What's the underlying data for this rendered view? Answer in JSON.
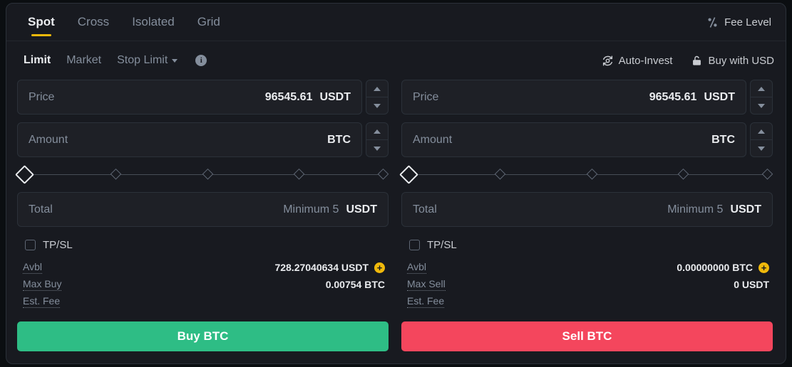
{
  "market_tabs": [
    {
      "label": "Spot",
      "active": true
    },
    {
      "label": "Cross",
      "active": false
    },
    {
      "label": "Isolated",
      "active": false
    },
    {
      "label": "Grid",
      "active": false
    }
  ],
  "fee_level": {
    "label": "Fee Level",
    "icon": "percent-icon"
  },
  "order_types": [
    {
      "label": "Limit",
      "active": true,
      "caret": false
    },
    {
      "label": "Market",
      "active": false,
      "caret": false
    },
    {
      "label": "Stop Limit",
      "active": false,
      "caret": true
    }
  ],
  "info_tooltip_icon": "info-icon",
  "quick_actions": [
    {
      "label": "Auto-Invest",
      "icon": "auto-invest-icon"
    },
    {
      "label": "Buy with USD",
      "icon": "bank-lock-icon"
    }
  ],
  "buy": {
    "price": {
      "label": "Price",
      "value": "96545.61",
      "unit": "USDT"
    },
    "amount": {
      "label": "Amount",
      "value": "",
      "unit": "BTC"
    },
    "slider": {
      "value": 0,
      "ticks": [
        0,
        25,
        50,
        75,
        100
      ]
    },
    "total": {
      "label": "Total",
      "hint": "Minimum 5",
      "unit": "USDT"
    },
    "tpsl": {
      "label": "TP/SL",
      "checked": false
    },
    "info": [
      {
        "key": "Avbl",
        "value": "728.27040634 USDT",
        "has_plus": true
      },
      {
        "key": "Max Buy",
        "value": "0.00754 BTC",
        "has_plus": false
      },
      {
        "key": "Est. Fee",
        "value": "",
        "has_plus": false
      }
    ],
    "button": {
      "label": "Buy BTC",
      "color": "#2ebd85"
    }
  },
  "sell": {
    "price": {
      "label": "Price",
      "value": "96545.61",
      "unit": "USDT"
    },
    "amount": {
      "label": "Amount",
      "value": "",
      "unit": "BTC"
    },
    "slider": {
      "value": 0,
      "ticks": [
        0,
        25,
        50,
        75,
        100
      ]
    },
    "total": {
      "label": "Total",
      "hint": "Minimum 5",
      "unit": "USDT"
    },
    "tpsl": {
      "label": "TP/SL",
      "checked": false
    },
    "info": [
      {
        "key": "Avbl",
        "value": "0.00000000 BTC",
        "has_plus": true
      },
      {
        "key": "Max Sell",
        "value": "0 USDT",
        "has_plus": false
      },
      {
        "key": "Est. Fee",
        "value": "",
        "has_plus": false
      }
    ],
    "button": {
      "label": "Sell BTC",
      "color": "#f4465d"
    }
  },
  "colors": {
    "accent": "#f0b90b",
    "buy": "#2ebd85",
    "sell": "#f4465d",
    "panel_bg": "#181a20",
    "field_bg": "#1e2026",
    "border": "#2b3139",
    "text": "#eaecef",
    "muted": "#848e9c"
  }
}
